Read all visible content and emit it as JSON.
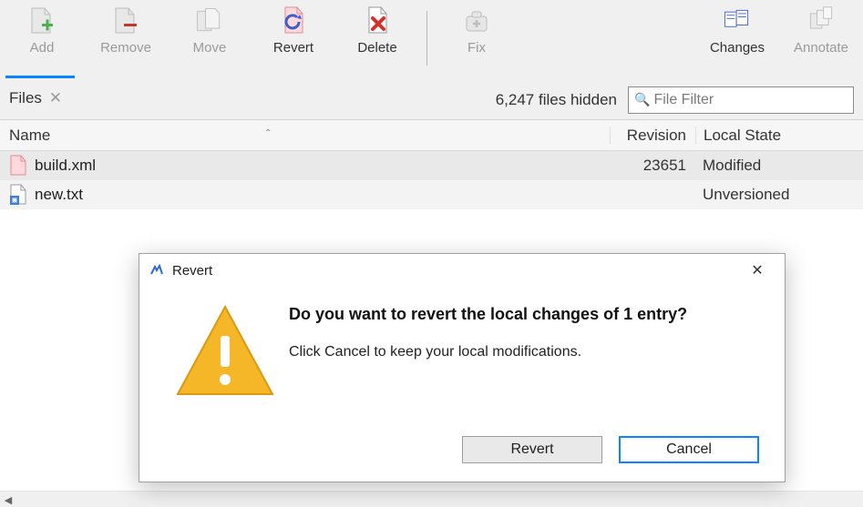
{
  "toolbar": {
    "add": "Add",
    "remove": "Remove",
    "move": "Move",
    "revert": "Revert",
    "delete": "Delete",
    "fix": "Fix",
    "changes": "Changes",
    "annotate": "Annotate"
  },
  "tabs": {
    "files": "Files",
    "hidden_count": "6,247 files hidden",
    "filter_placeholder": "File Filter"
  },
  "columns": {
    "name": "Name",
    "revision": "Revision",
    "local_state": "Local State"
  },
  "rows": [
    {
      "name": "build.xml",
      "revision": "23651",
      "state": "Modified"
    },
    {
      "name": "new.txt",
      "revision": "",
      "state": "Unversioned"
    }
  ],
  "dialog": {
    "title": "Revert",
    "heading": "Do you want to revert the local changes of 1 entry?",
    "sub": "Click Cancel to keep your local modifications.",
    "revert": "Revert",
    "cancel": "Cancel"
  }
}
